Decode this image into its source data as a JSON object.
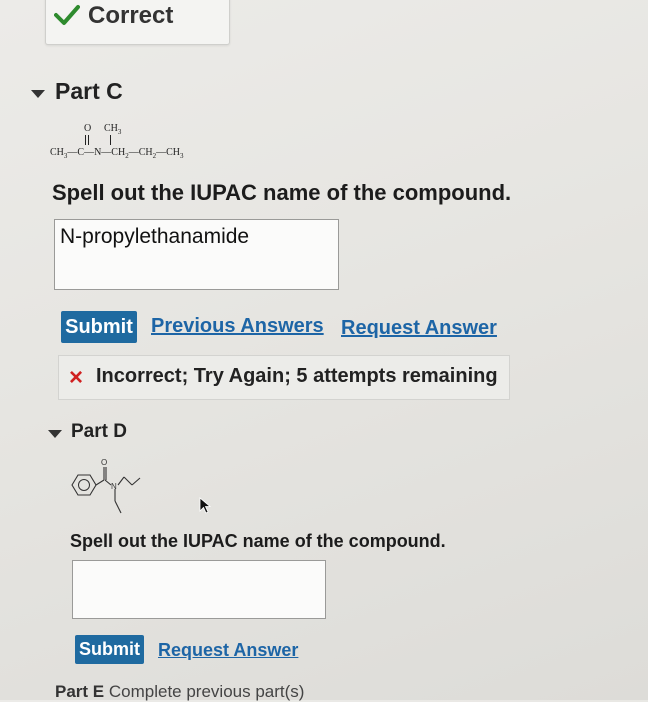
{
  "status_banner": {
    "label": "Correct",
    "color": "#2e8b2e"
  },
  "part_c": {
    "title": "Part C",
    "structure": {
      "top_o": "O",
      "top_ch3": "CH",
      "ch3_sub": "3",
      "chain": [
        "CH",
        "3",
        "—C—N—CH",
        "2",
        "—CH",
        "2",
        "—CH",
        "3"
      ]
    },
    "prompt": "Spell out the IUPAC name of the compound.",
    "answer_value": "N-propylethanamide",
    "submit_label": "Submit",
    "previous_answers_label": "Previous Answers",
    "request_answer_label": "Request Answer",
    "feedback_icon": "×",
    "feedback_text": "Incorrect; Try Again; 5 attempts remaining"
  },
  "part_d": {
    "title": "Part D",
    "structure_labels": {
      "o": "O",
      "n": "N"
    },
    "prompt": "Spell out the IUPAC name of the compound.",
    "answer_value": "",
    "submit_label": "Submit",
    "request_answer_label": "Request Answer"
  },
  "part_e": {
    "title": "Part E",
    "note": "Complete previous part(s)"
  },
  "colors": {
    "accent": "#1f6aa0",
    "error": "#d02020",
    "success": "#2e8b2e"
  }
}
